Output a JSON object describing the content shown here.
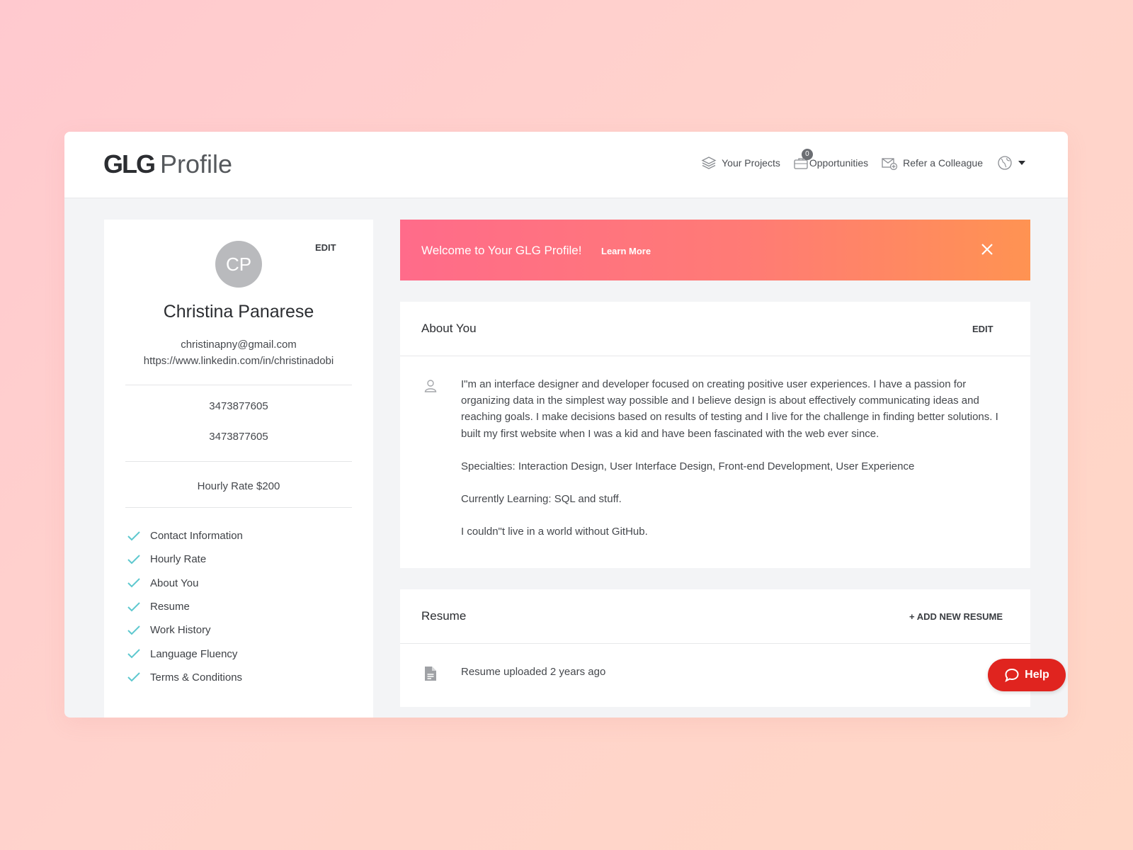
{
  "header": {
    "brand_bold": "GLG",
    "brand_light": "Profile",
    "nav": {
      "projects": "Your Projects",
      "opportunities": "Opportunities",
      "opportunities_count": "0",
      "refer": "Refer a Colleague"
    }
  },
  "profile": {
    "initials": "CP",
    "edit_label": "EDIT",
    "name": "Christina Panarese",
    "email": "christinapny@gmail.com",
    "linkedin": "https://www.linkedin.com/in/christinadobi",
    "phone_1": "3473877605",
    "phone_2": "3473877605",
    "hourly_rate": "Hourly Rate $200",
    "checklist": [
      "Contact Information",
      "Hourly Rate",
      "About You",
      "Resume",
      "Work History",
      "Language Fluency",
      "Terms & Conditions"
    ]
  },
  "banner": {
    "text": "Welcome to Your GLG Profile!",
    "link": "Learn More"
  },
  "about": {
    "title": "About You",
    "edit_label": "EDIT",
    "paragraphs": [
      "I\"m an interface designer and developer focused on creating positive user experiences. I have a passion for organizing data in the simplest way possible and I believe design is about effectively communicating ideas and reaching goals. I make decisions based on results of testing and I live for the challenge in finding better solutions. I built my first website when I was a kid and have been fascinated with the web ever since.",
      "Specialties: Interaction Design, User Interface Design, Front-end Development, User Experience",
      "Currently Learning: SQL and stuff.",
      "I couldn\"t live in a world without GitHub."
    ]
  },
  "resume": {
    "title": "Resume",
    "add_label": "+ ADD NEW RESUME",
    "uploaded_text": "Resume uploaded 2 years ago"
  },
  "help": {
    "label": "Help"
  },
  "colors": {
    "banner_start": "#ff6b8a",
    "banner_end": "#ff9352",
    "check": "#5ec8cf",
    "help": "#e0241f"
  }
}
